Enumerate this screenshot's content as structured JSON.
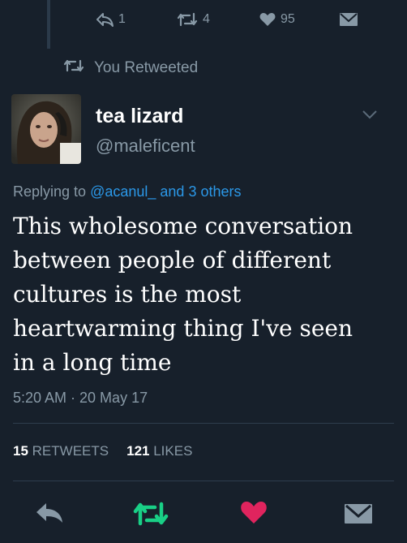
{
  "top_actions": {
    "reply_count": "1",
    "retweet_count": "4",
    "like_count": "95"
  },
  "retweet_notice": "You Retweeted",
  "tweet": {
    "display_name": "tea lizard",
    "handle": "@maleficent",
    "replying_prefix": "Replying to",
    "replying_targets": "@acanul_ and 3 others",
    "text": "This wholesome conversation\nbetween people of different\ncultures is the most\nheartwarming thing I've seen\nin a long time",
    "timestamp": "5:20 AM · 20 May 17",
    "retweets": "15",
    "retweets_label": "RETWEETS",
    "likes": "121",
    "likes_label": "LIKES"
  },
  "icons": {
    "reply": "reply-icon",
    "retweet": "retweet-icon",
    "like": "heart-icon",
    "message": "message-icon",
    "caret": "chevron-down-icon"
  },
  "colors": {
    "background": "#17202b",
    "muted": "#8899a6",
    "link": "#2b98e8",
    "retweet_active": "#19cf86",
    "like_active": "#e0245e"
  }
}
